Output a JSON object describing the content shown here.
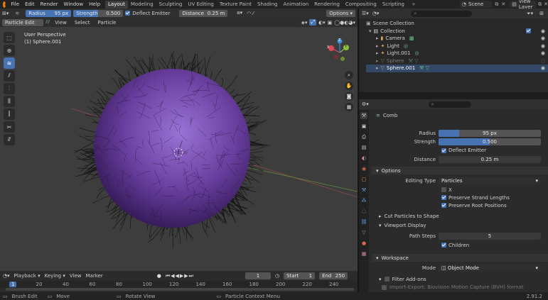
{
  "topbar": {
    "menus": [
      "File",
      "Edit",
      "Render",
      "Window",
      "Help"
    ],
    "workspaces": [
      "Layout",
      "Modeling",
      "Sculpting",
      "UV Editing",
      "Texture Paint",
      "Shading",
      "Animation",
      "Rendering",
      "Compositing",
      "Scripting"
    ],
    "active_workspace": "Layout",
    "scene": "Scene",
    "view_layer": "View Layer"
  },
  "viewport": {
    "tool_header": {
      "radius_label": "Radius",
      "radius_value": "95 px",
      "strength_label": "Strength",
      "strength_value": "0.500",
      "deflect_label": "Deflect Emitter",
      "distance_label": "Distance",
      "distance_value": "0.25 m",
      "options_label": "Options"
    },
    "header": {
      "mode": "Particle Edit",
      "menus": [
        "View",
        "Select",
        "Particle"
      ]
    },
    "overlay_title": "User Perspective",
    "overlay_object": "(1) Sphere.001",
    "gizmo": {
      "x": "X",
      "y": "Y",
      "z": "Z"
    },
    "colors": {
      "accent": "#4772b3",
      "sphere": "#6a3fa0"
    }
  },
  "timeline": {
    "menus": [
      "Playback",
      "Keying",
      "View",
      "Marker"
    ],
    "current_frame": "1",
    "start_label": "Start",
    "start": "1",
    "end_label": "End",
    "end": "250",
    "ruler": [
      "1",
      "20",
      "40",
      "60",
      "80",
      "100",
      "120",
      "140",
      "160",
      "180",
      "200",
      "220",
      "240"
    ]
  },
  "status": {
    "items": [
      "Brush Edit",
      "Move",
      "Rotate View",
      "Particle Context Menu"
    ],
    "version": "2.91.2"
  },
  "outliner": {
    "root": "Scene Collection",
    "collection": "Collection",
    "items": [
      {
        "name": "Camera"
      },
      {
        "name": "Light"
      },
      {
        "name": "Light.001"
      },
      {
        "name": "Sphere"
      },
      {
        "name": "Sphere.001"
      }
    ]
  },
  "properties": {
    "tool_name": "Comb",
    "radius_label": "Radius",
    "radius_value": "95 px",
    "strength_label": "Strength",
    "strength_value": "0.500",
    "deflect_label": "Deflect Emitter",
    "distance_label": "Distance",
    "distance_value": "0.25 m",
    "options_title": "Options",
    "editing_type_label": "Editing Type",
    "editing_type_value": "Particles",
    "x_label": "X",
    "preserve_strand": "Preserve Strand Lengths",
    "preserve_root": "Preserve Root Positions",
    "cut_particles": "Cut Particles to Shape",
    "viewport_display": "Viewport Display",
    "path_steps_label": "Path Steps",
    "path_steps_value": "5",
    "children_label": "Children",
    "workspace_title": "Workspace",
    "mode_label": "Mode",
    "mode_value": "Object Mode",
    "filter_addons": "Filter Add-ons",
    "addon_line": "Import-Export: Biovision Motion Capture (BVH) format"
  }
}
